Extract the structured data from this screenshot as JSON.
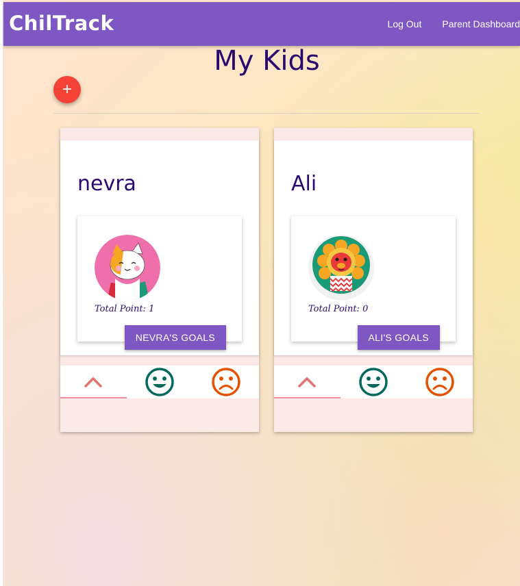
{
  "navbar": {
    "brand": "ChilTrack",
    "links": [
      "Log Out",
      "Parent Dashboard"
    ]
  },
  "page": {
    "title": "My Kids",
    "add_button": "+"
  },
  "kids": [
    {
      "name": "nevra",
      "points_label": "Total Point: 1",
      "goals_label": "NEVRA'S GOALS",
      "avatar": "cat-avatar"
    },
    {
      "name": "Ali",
      "points_label": "Total Point: 0",
      "goals_label": "ALI'S GOALS",
      "avatar": "lion-avatar"
    }
  ],
  "tabs": {
    "icons": [
      "chevron-up-icon",
      "happy-face-icon",
      "sad-face-icon"
    ]
  },
  "colors": {
    "primary": "#7e57c2",
    "fab": "#f44336",
    "title": "#2a0870",
    "happy": "#00695c",
    "sad": "#e65100",
    "chevron": "#e57373"
  }
}
